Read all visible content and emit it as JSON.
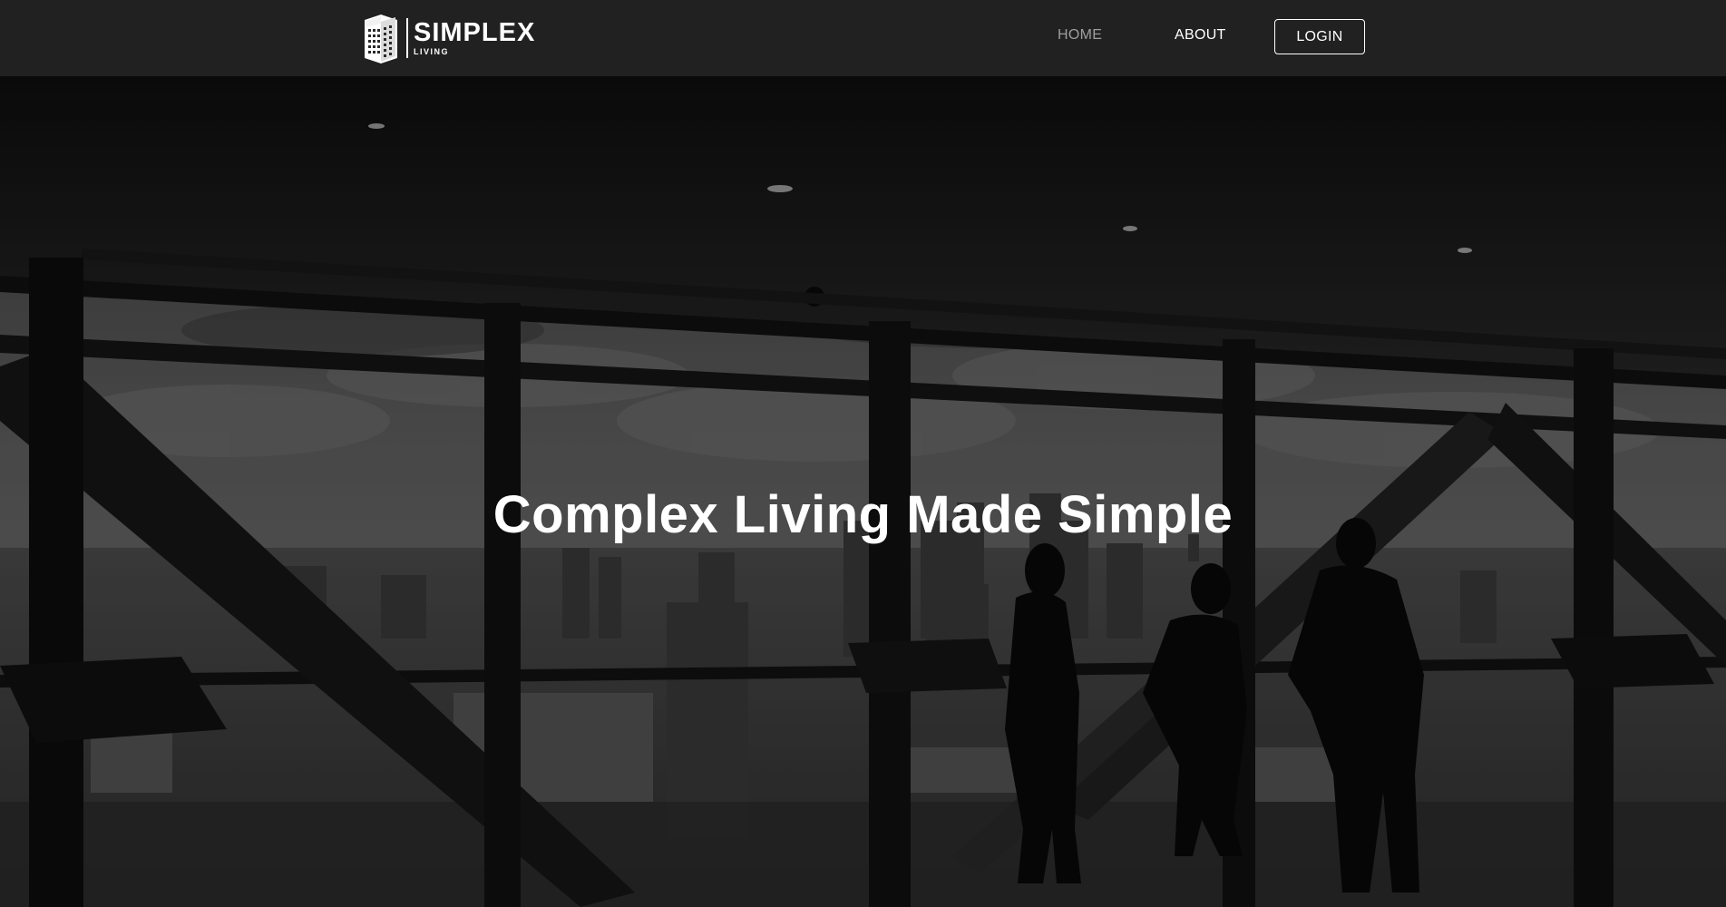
{
  "navbar": {
    "logo": {
      "name": "SIMPLEX",
      "tagline": "LIVING",
      "icon": "building-icon"
    },
    "links": {
      "home": "HOME",
      "about": "ABOUT",
      "login": "LOGIN"
    }
  },
  "hero": {
    "title": "Complex Living Made Simple"
  },
  "colors": {
    "navbar_bg": "#212121",
    "nav_inactive": "#9e9e9e",
    "nav_active": "#ffffff",
    "hero_overlay": "#000000"
  }
}
